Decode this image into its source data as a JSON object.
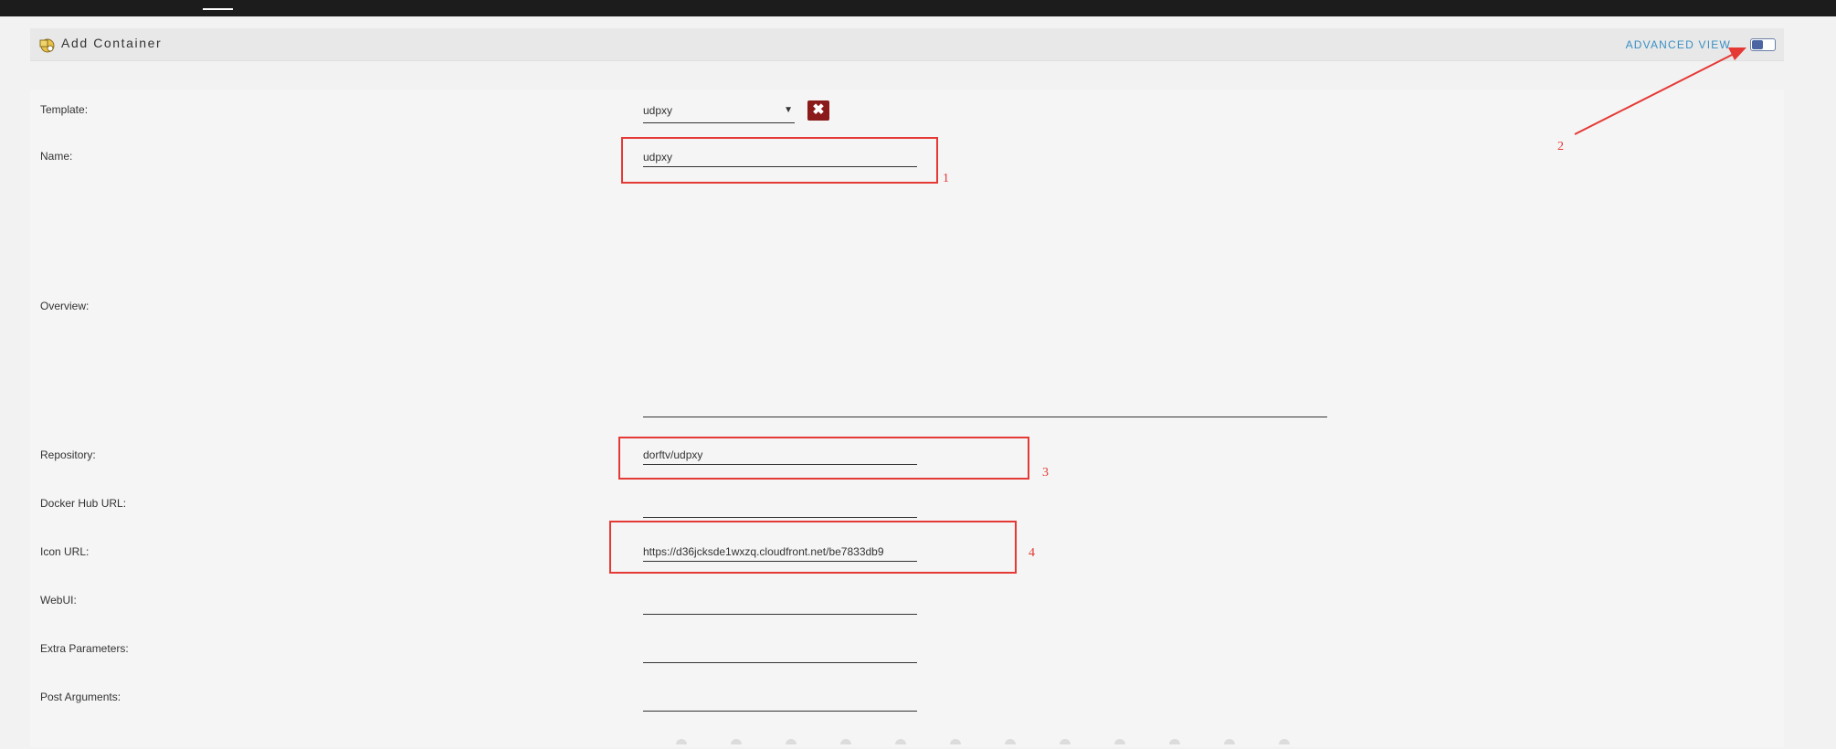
{
  "header": {
    "title": "Add Container",
    "advanced_view_label": "ADVANCED VIEW",
    "icon": "container-add-icon"
  },
  "form": {
    "template_label": "Template:",
    "template_value": "udpxy",
    "name_label": "Name:",
    "name_value": "udpxy",
    "overview_label": "Overview:",
    "repository_label": "Repository:",
    "repository_value": "dorftv/udpxy",
    "docker_hub_url_label": "Docker Hub URL:",
    "docker_hub_url_value": "",
    "icon_url_label": "Icon URL:",
    "icon_url_value": "https://d36jcksde1wxzq.cloudfront.net/be7833db9",
    "webui_label": "WebUI:",
    "webui_value": "",
    "extra_parameters_label": "Extra Parameters:",
    "extra_parameters_value": "",
    "post_arguments_label": "Post Arguments:",
    "post_arguments_value": ""
  },
  "annotations": {
    "one": "1",
    "two": "2",
    "three": "3",
    "four": "4"
  },
  "colors": {
    "accent": "#3a8fc4",
    "annotation": "#e53935",
    "remove_button": "#8b1a1a"
  }
}
